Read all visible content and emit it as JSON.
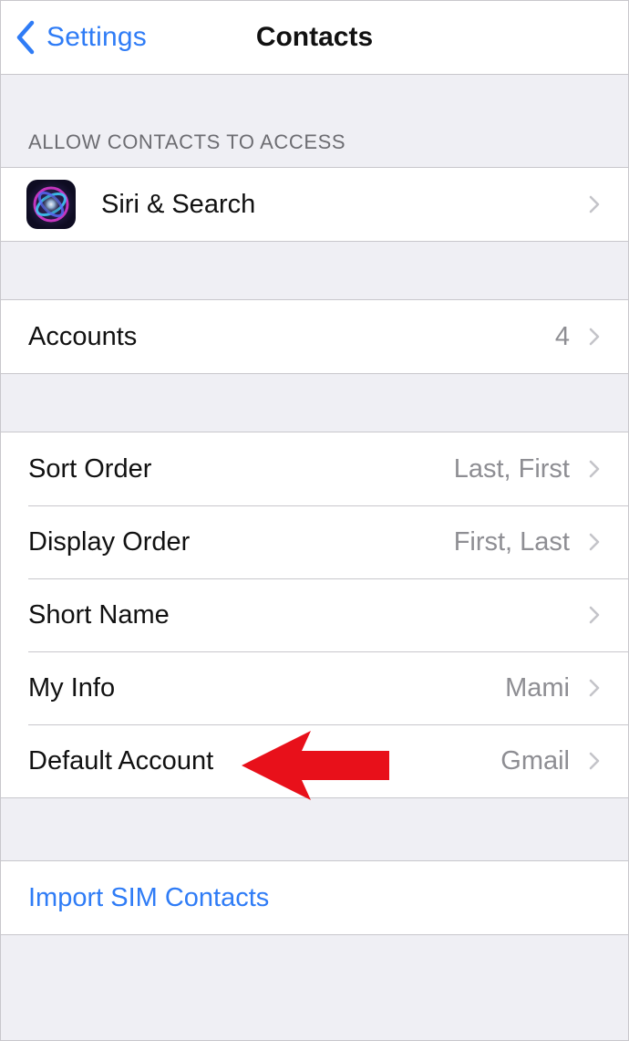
{
  "navbar": {
    "back_label": "Settings",
    "title": "Contacts"
  },
  "section": {
    "header": "ALLOW CONTACTS TO ACCESS"
  },
  "siri_row": {
    "label": "Siri & Search"
  },
  "accounts_row": {
    "label": "Accounts",
    "value": "4"
  },
  "settings": [
    {
      "label": "Sort Order",
      "value": "Last, First"
    },
    {
      "label": "Display Order",
      "value": "First, Last"
    },
    {
      "label": "Short Name",
      "value": ""
    },
    {
      "label": "My Info",
      "value": "Mami"
    },
    {
      "label": "Default Account",
      "value": "Gmail"
    }
  ],
  "import_row": {
    "label": "Import SIM Contacts"
  },
  "colors": {
    "accent": "#2f7cf6",
    "background": "#efeff4",
    "annotation_arrow": "#e8101a"
  },
  "icons": {
    "back": "chevron-left-icon",
    "disclosure": "chevron-right-icon",
    "siri": "siri-icon",
    "annotation": "red-arrow-icon"
  }
}
